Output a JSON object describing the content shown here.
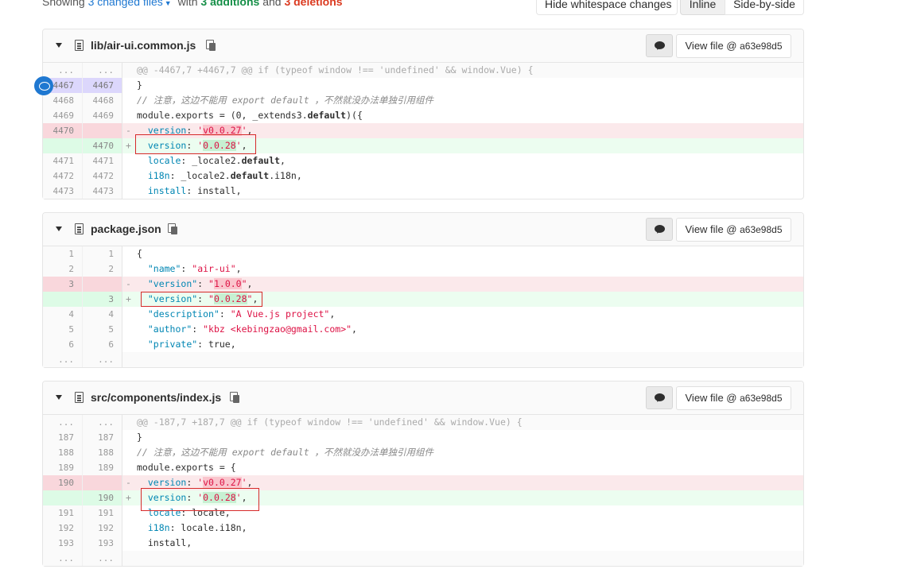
{
  "summary": {
    "prefix": "Showing",
    "files_link": "3 changed files",
    "with": "with",
    "additions": "3 additions",
    "and": "and",
    "deletions": "3 deletions"
  },
  "toolbar": {
    "whitespace": "Hide whitespace changes",
    "inline": "Inline",
    "side_by_side": "Side-by-side"
  },
  "files": [
    {
      "name": "lib/air-ui.common.js",
      "view_label": "View file @",
      "sha": "a63e98d5",
      "lines": [
        {
          "type": "match",
          "old": "...",
          "new": "...",
          "text": "@@ -4467,7 +4467,7 @@ if (typeof window !== 'undefined' && window.Vue) {"
        },
        {
          "type": "ctx",
          "old": "4467",
          "new": "4467",
          "text": "}"
        },
        {
          "type": "ctx",
          "old": "4468",
          "new": "4468",
          "text": "// 注意，这边不能用 export default ，不然就没办法单独引用组件"
        },
        {
          "type": "ctx",
          "old": "4469",
          "new": "4469",
          "text": "module.exports = (0, _extends3.default)({"
        },
        {
          "type": "del",
          "old": "4470",
          "new": "",
          "text": "  version: 'v0.0.27',"
        },
        {
          "type": "add",
          "old": "",
          "new": "4470",
          "text": "  version: '0.0.28',"
        },
        {
          "type": "ctx",
          "old": "4471",
          "new": "4471",
          "text": "  locale: _locale2.default,"
        },
        {
          "type": "ctx",
          "old": "4472",
          "new": "4472",
          "text": "  i18n: _locale2.default.i18n,"
        },
        {
          "type": "ctx",
          "old": "4473",
          "new": "4473",
          "text": "  install: install,"
        }
      ]
    },
    {
      "name": "package.json",
      "view_label": "View file @",
      "sha": "a63e98d5",
      "lines": [
        {
          "type": "ctx",
          "old": "1",
          "new": "1",
          "text": "{"
        },
        {
          "type": "ctx",
          "old": "2",
          "new": "2",
          "text": "  \"name\": \"air-ui\","
        },
        {
          "type": "del",
          "old": "3",
          "new": "",
          "text": "  \"version\": \"1.0.0\","
        },
        {
          "type": "add",
          "old": "",
          "new": "3",
          "text": "  \"version\": \"0.0.28\","
        },
        {
          "type": "ctx",
          "old": "4",
          "new": "4",
          "text": "  \"description\": \"A Vue.js project\","
        },
        {
          "type": "ctx",
          "old": "5",
          "new": "5",
          "text": "  \"author\": \"kbz <kebingzao@gmail.com>\","
        },
        {
          "type": "ctx",
          "old": "6",
          "new": "6",
          "text": "  \"private\": true,"
        },
        {
          "type": "match",
          "old": "...",
          "new": "...",
          "text": ""
        }
      ]
    },
    {
      "name": "src/components/index.js",
      "view_label": "View file @",
      "sha": "a63e98d5",
      "lines": [
        {
          "type": "match",
          "old": "...",
          "new": "...",
          "text": "@@ -187,7 +187,7 @@ if (typeof window !== 'undefined' && window.Vue) {"
        },
        {
          "type": "ctx",
          "old": "187",
          "new": "187",
          "text": "}"
        },
        {
          "type": "ctx",
          "old": "188",
          "new": "188",
          "text": "// 注意，这边不能用 export default ，不然就没办法单独引用组件"
        },
        {
          "type": "ctx",
          "old": "189",
          "new": "189",
          "text": "module.exports = {"
        },
        {
          "type": "del",
          "old": "190",
          "new": "",
          "text": "  version: 'v0.0.27',"
        },
        {
          "type": "add",
          "old": "",
          "new": "190",
          "text": "  version: '0.0.28',"
        },
        {
          "type": "ctx",
          "old": "191",
          "new": "191",
          "text": "  locale: locale,"
        },
        {
          "type": "ctx",
          "old": "192",
          "new": "192",
          "text": "  i18n: locale.i18n,"
        },
        {
          "type": "ctx",
          "old": "193",
          "new": "193",
          "text": "  install,"
        },
        {
          "type": "match",
          "old": "...",
          "new": "...",
          "text": ""
        }
      ]
    }
  ],
  "colors": {
    "link": "#1f78d1",
    "addition": "#168f48",
    "deletion": "#db3b21",
    "annotation_box": "#d62a2a"
  }
}
